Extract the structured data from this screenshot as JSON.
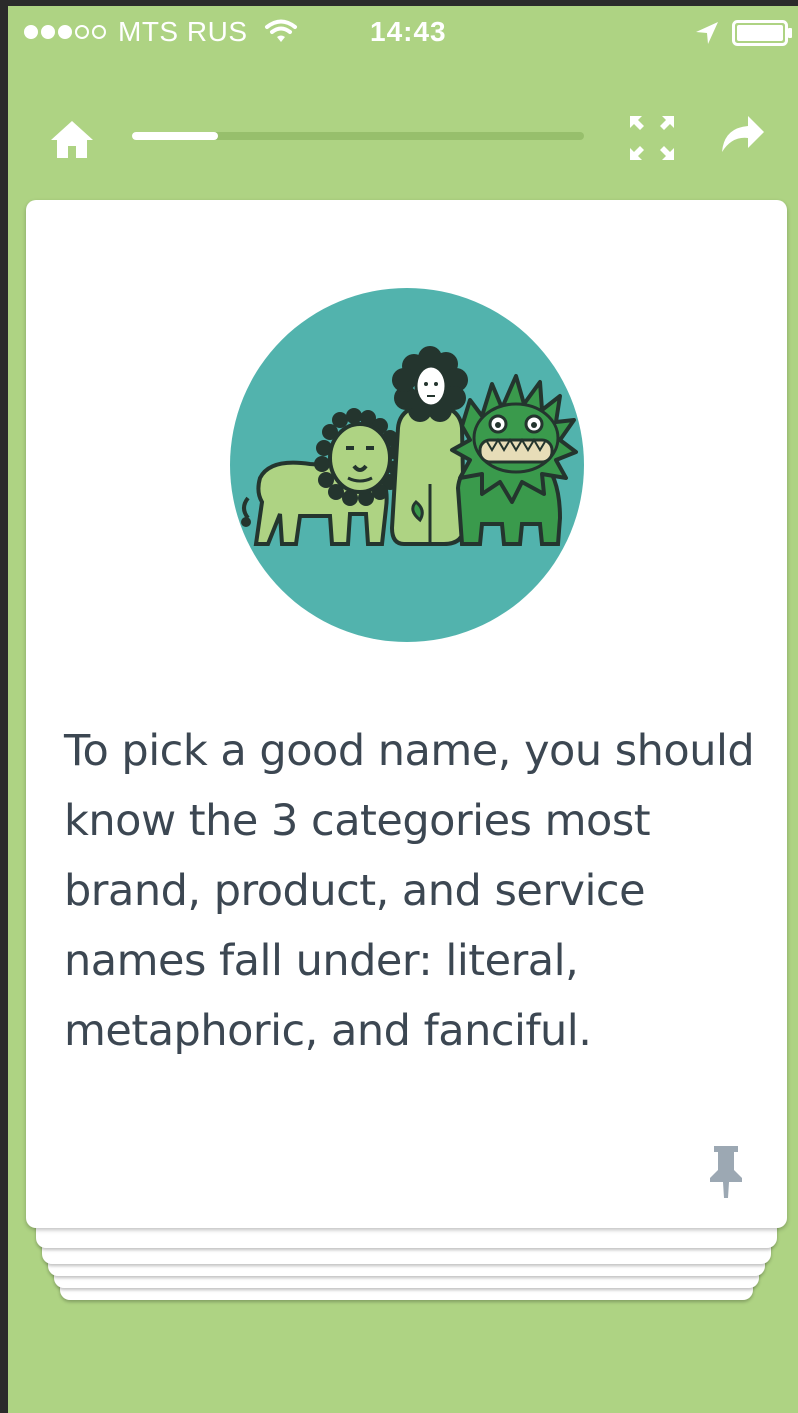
{
  "status_bar": {
    "signal_dots": [
      true,
      true,
      true,
      false,
      false
    ],
    "carrier": "MTS RUS",
    "time": "14:43",
    "icons": [
      "wifi-icon",
      "location-arrow-icon",
      "battery-icon"
    ]
  },
  "toolbar": {
    "icons": [
      "home-icon",
      "expand-icon",
      "share-icon"
    ],
    "progress_fraction": 0.19
  },
  "card": {
    "image": "lion-and-monsters-illustration",
    "text": "To pick a good name, you should know the 3 categories most brand, product, and service names fall under: literal, metaphoric, and fanciful.",
    "pin_icon": "pin-icon"
  },
  "colors": {
    "background": "#aed383",
    "card": "#ffffff",
    "illustration_circle": "#52b3ad",
    "text": "#3c4752",
    "icon_muted": "#9ca8b3"
  }
}
